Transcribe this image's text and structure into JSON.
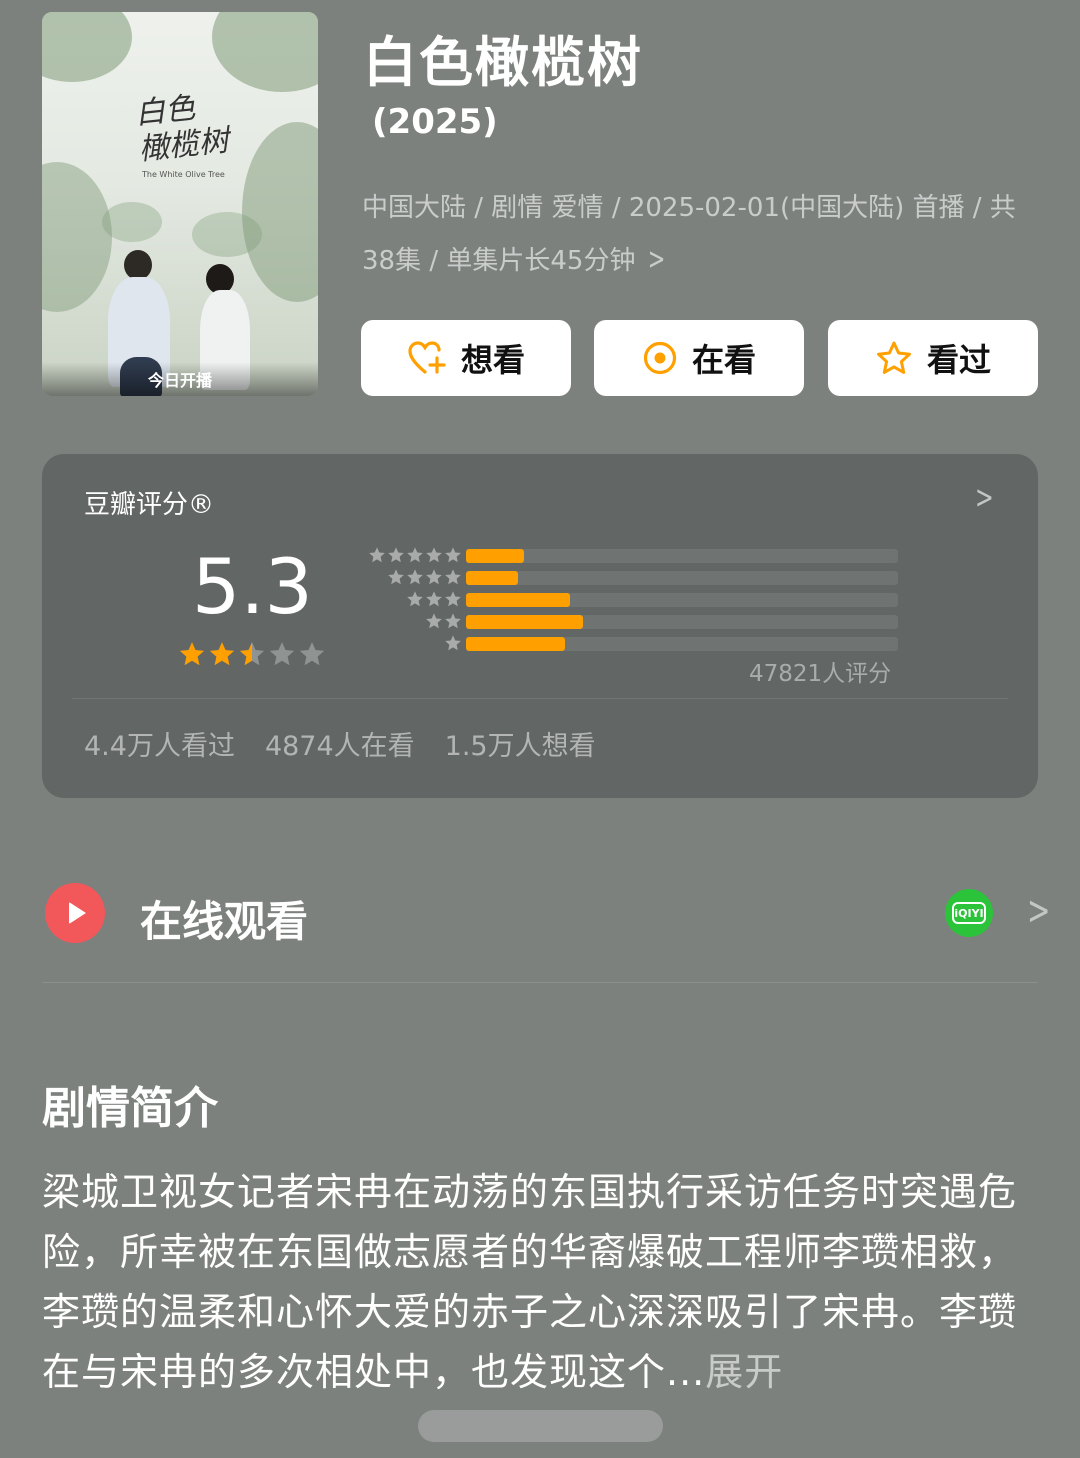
{
  "poster": {
    "title_art": "白色\n橄榄树",
    "title_en": "The White Olive Tree",
    "badge": "今日开播"
  },
  "header": {
    "title": "白色橄榄树",
    "year": "(2025)",
    "meta": "中国大陆 / 剧情 爱情 / 2025-02-01(中国大陆) 首播 / 共38集 / 单集片长45分钟"
  },
  "actions": [
    {
      "label": "想看",
      "icon": "heart-plus-icon"
    },
    {
      "label": "在看",
      "icon": "target-circle-icon"
    },
    {
      "label": "看过",
      "icon": "star-outline-icon"
    }
  ],
  "rating": {
    "label": "豆瓣评分®",
    "score": "5.3",
    "stars": 2.5,
    "distribution": [
      {
        "stars": 5,
        "fraction": 0.135
      },
      {
        "stars": 4,
        "fraction": 0.12
      },
      {
        "stars": 3,
        "fraction": 0.24
      },
      {
        "stars": 2,
        "fraction": 0.27
      },
      {
        "stars": 1,
        "fraction": 0.23
      }
    ],
    "count": "47821人评分",
    "stats": [
      "4.4万人看过",
      "4874人在看",
      "1.5万人想看"
    ]
  },
  "online": {
    "label": "在线观看",
    "provider_icon": "iqiyi-icon",
    "provider_text": "iQIYI"
  },
  "synopsis": {
    "title": "剧情简介",
    "text": "梁城卫视女记者宋冉在动荡的东国执行采访任务时突遇危险，所幸被在东国做志愿者的华裔爆破工程师李瓒相救，李瓒的温柔和心怀大爱的赤子之心深深吸引了宋冉。李瓒在与宋冉的多次相处中，也发现这个...",
    "expand": "展开"
  },
  "colors": {
    "accent": "#ffa000",
    "play": "#f2575a",
    "iqiyi": "#2ac33a",
    "background": "#7d817e"
  }
}
